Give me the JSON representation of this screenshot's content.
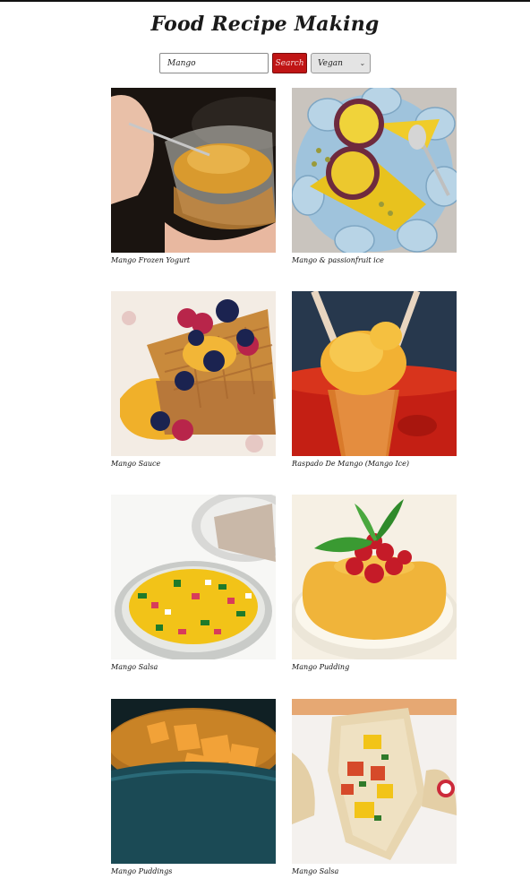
{
  "app": {
    "title": "Food Recipe Making"
  },
  "search": {
    "value": "Mango",
    "button_label": "Search",
    "diet_selected": "Vegan"
  },
  "recipes": [
    {
      "name": "Mango Frozen Yogurt"
    },
    {
      "name": "Mango & passionfruit ice"
    },
    {
      "name": "Mango Sauce"
    },
    {
      "name": "Raspado De Mango (Mango Ice)"
    },
    {
      "name": "Mango Salsa"
    },
    {
      "name": "Mango Pudding"
    },
    {
      "name": "Mango Puddings"
    },
    {
      "name": "Mango Salsa"
    }
  ]
}
